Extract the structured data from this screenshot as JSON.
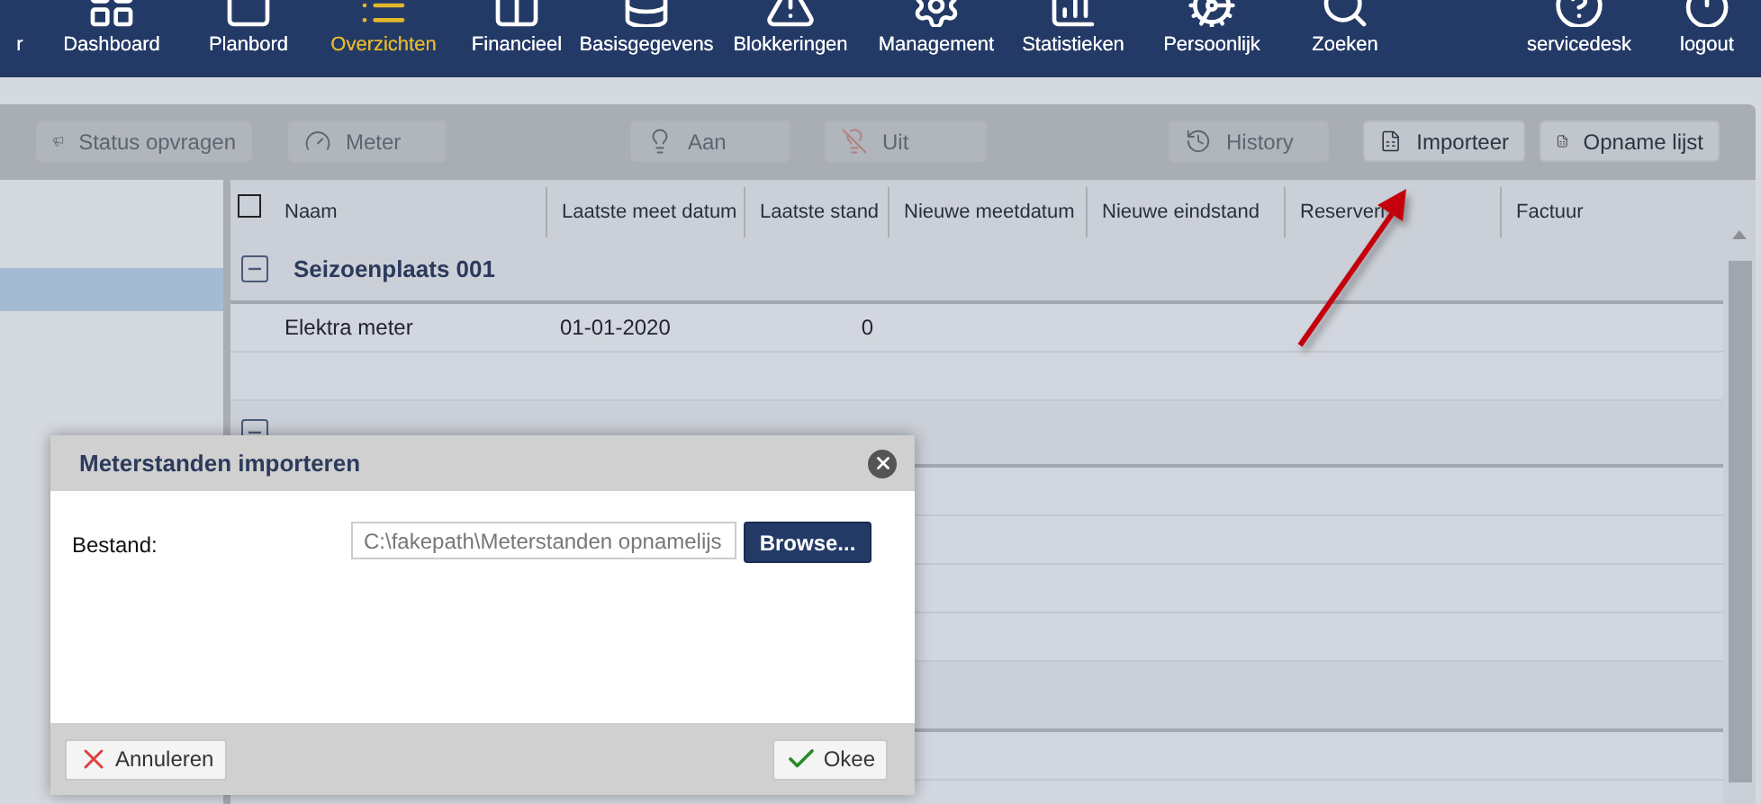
{
  "nav": [
    {
      "label": "r",
      "selected": false
    },
    {
      "label": "Dashboard",
      "selected": false
    },
    {
      "label": "Planbord",
      "selected": false
    },
    {
      "label": "Overzichten",
      "selected": true
    },
    {
      "label": "Financieel",
      "selected": false
    },
    {
      "label": "Basisgegevens",
      "selected": false
    },
    {
      "label": "Blokkeringen",
      "selected": false
    },
    {
      "label": "Management",
      "selected": false
    },
    {
      "label": "Statistieken",
      "selected": false
    },
    {
      "label": "Persoonlijk",
      "selected": false
    },
    {
      "label": "Zoeken",
      "selected": false
    }
  ],
  "nav_right": [
    {
      "label": "servicedesk"
    },
    {
      "label": "logout"
    }
  ],
  "toolbar": [
    {
      "label": "Status opvragen",
      "disabled": true
    },
    {
      "label": "Meter",
      "disabled": true
    },
    {
      "label": "Aan",
      "disabled": true
    },
    {
      "label": "Uit",
      "disabled": true
    },
    {
      "label": "History",
      "disabled": true
    },
    {
      "label": "Importeer",
      "disabled": false
    },
    {
      "label": "Opname lijst",
      "disabled": false
    }
  ],
  "sidebar": {
    "items": [
      {
        "selected": true
      }
    ]
  },
  "table": {
    "select_all": {
      "checked": false
    },
    "columns": [
      "Naam",
      "Laatste meet datum",
      "Laatste stand",
      "Nieuwe meetdatum",
      "Nieuwe eindstand",
      "Reserveri",
      "Factuur"
    ],
    "groups": [
      {
        "title": "Seizoenplaats 001",
        "expanded": true,
        "rows": [
          {
            "cells": [
              "Elektra meter",
              "01-01-2020",
              "0"
            ]
          }
        ]
      },
      {
        "expanded": true
      }
    ]
  },
  "dialog": {
    "title": "Meterstanden importeren",
    "field_label": "Bestand:",
    "file_value": "C:\\fakepath\\Meterstanden opnamelijs",
    "browse": "Browse...",
    "cancel": "Annuleren",
    "ok": "Okee"
  }
}
